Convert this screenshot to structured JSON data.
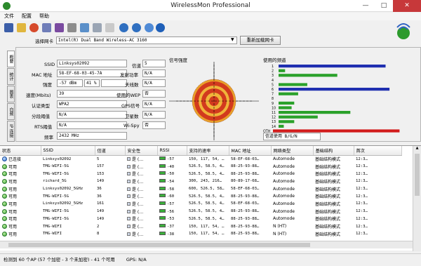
{
  "window": {
    "title": "WirelessMon Professional",
    "min": "—",
    "max": "□",
    "close": "✕"
  },
  "menu": [
    "文件",
    "配置",
    "帮助"
  ],
  "adapter": {
    "label": "选择网卡",
    "value": "Intel(R) Dual Band Wireless-AC 3160",
    "reload": "重新加载网卡"
  },
  "tabs": [
    "概要",
    "统计",
    "图表",
    "白频",
    "IP 连接"
  ],
  "info": {
    "ssid": {
      "label": "SSID",
      "value": "Linksys02092"
    },
    "mac": {
      "label": "MAC 地址",
      "value": "58-EF-68-03-45-7A"
    },
    "strength": {
      "label": "强度",
      "value": "-57 dBm",
      "pct": "41 %"
    },
    "speed": {
      "label": "速度(Mbits)",
      "value": "39"
    },
    "auth": {
      "label": "认证类型",
      "value": "WPA2"
    },
    "frag": {
      "label": "分段阈值",
      "value": "N/A"
    },
    "rts": {
      "label": "RTS阈值",
      "value": "N/A"
    },
    "freq": {
      "label": "频率",
      "value": "2432 MHz"
    },
    "channel": {
      "label": "信道",
      "value": "5"
    },
    "txpower": {
      "label": "发射功率",
      "value": "N/A"
    },
    "antenna": {
      "label": "天线数",
      "value": "N/A"
    },
    "encryption": {
      "label": "使用的WEP",
      "value": "否"
    },
    "gps": {
      "label": "GPS信号",
      "value": "N/A"
    },
    "sats": {
      "label": "卫星数",
      "value": "N/A"
    },
    "wispy": {
      "label": "Wi-Spy",
      "value": "否"
    }
  },
  "signal_title": "信号强度",
  "channels_title": "使用的频道",
  "channel_select": "信道使用 B/G/N",
  "channel_usage": {
    "labels": [
      "1",
      "2",
      "3",
      "4",
      "5",
      "6",
      "7",
      "8",
      "9",
      "10",
      "11",
      "12",
      "13",
      "14",
      "OTH"
    ],
    "values": [
      0.82,
      0.05,
      0.45,
      0,
      0.22,
      0.85,
      0.15,
      0,
      0.12,
      0.1,
      0.55,
      0.3,
      0.12,
      0.04,
      0.97
    ],
    "colors": [
      "#1f2fb0",
      "#2aa12a",
      "#2aa12a",
      "#2aa12a",
      "#2aa12a",
      "#1f2fb0",
      "#2aa12a",
      "#2aa12a",
      "#2aa12a",
      "#2aa12a",
      "#2aa12a",
      "#2aa12a",
      "#2aa12a",
      "#2aa12a",
      "#d21b1b"
    ]
  },
  "grid": {
    "headers": [
      "状态",
      "SSID",
      "信道",
      "安全性",
      "RSSI",
      "支持的速率",
      "MAC 地址",
      "网络类型",
      "基础结构",
      "首次"
    ],
    "rows": [
      [
        "已连接",
        "Linksys02092",
        "5",
        "是 (…",
        "-57",
        "150, 117, 54, …",
        "58-EF-68-03…",
        "Automode",
        "基础结构模式",
        "12:3…"
      ],
      [
        "可用",
        "TMG-WIFI-5G",
        "157",
        "是 (…",
        "-40",
        "526.5, 58.5, 4…",
        "88-25-93-88…",
        "Automode",
        "基础结构模式",
        "12:3…"
      ],
      [
        "可用",
        "TMG-WIFI-5G",
        "153",
        "是 (…",
        "-50",
        "526.5, 58.5, 4…",
        "88-25-93-88…",
        "Automode",
        "基础结构模式",
        "12:3…"
      ],
      [
        "可用",
        "richard_5G",
        "149",
        "是 (…",
        "-54",
        "300, 243, 216…",
        "80-89-17-68…",
        "Automode",
        "基础结构模式",
        "12:3…"
      ],
      [
        "可用",
        "Linksys02092_5GHz",
        "36",
        "是 (…",
        "-58",
        "600, 526.5, 58…",
        "58-EF-68-03…",
        "Automode",
        "基础结构模式",
        "12:3…"
      ],
      [
        "可用",
        "TMG-WIFI-5G",
        "36",
        "是 (…",
        "-60",
        "526.5, 58.5, 4…",
        "88-25-93-88…",
        "Automode",
        "基础结构模式",
        "12:3…"
      ],
      [
        "可用",
        "Linksys02092_5GHz",
        "161",
        "是 (…",
        "-57",
        "526.5, 58.5, 4…",
        "58-EF-68-03…",
        "Automode",
        "基础结构模式",
        "12:3…"
      ],
      [
        "可用",
        "TMG-WIFI-5G",
        "149",
        "是 (…",
        "-56",
        "526.5, 58.5, 4…",
        "88-25-93-88…",
        "Automode",
        "基础结构模式",
        "12:3…"
      ],
      [
        "可用",
        "TMG-WIFI-5G",
        "149",
        "是 (…",
        "-53",
        "526.5, 58.5, 4…",
        "88-25-93-88…",
        "Automode",
        "基础结构模式",
        "12:3…"
      ],
      [
        "可用",
        "TMG-WIFI",
        "2",
        "是 (…",
        "-37",
        "150, 117, 54, …",
        "88-25-93-88…",
        "N (HT)",
        "基础结构模式",
        "12:3…"
      ],
      [
        "可用",
        "TMG-WIFI",
        "8",
        "是 (…",
        "-38",
        "150, 117, 54, …",
        "88-25-93-88…",
        "N (HT)",
        "基础结构模式",
        "12:3…"
      ]
    ]
  },
  "status": {
    "summary": "检测到 60 个AP (57 个加密 - 3 个未加密) - 41 个可用",
    "gps": "GPS: N/A"
  }
}
